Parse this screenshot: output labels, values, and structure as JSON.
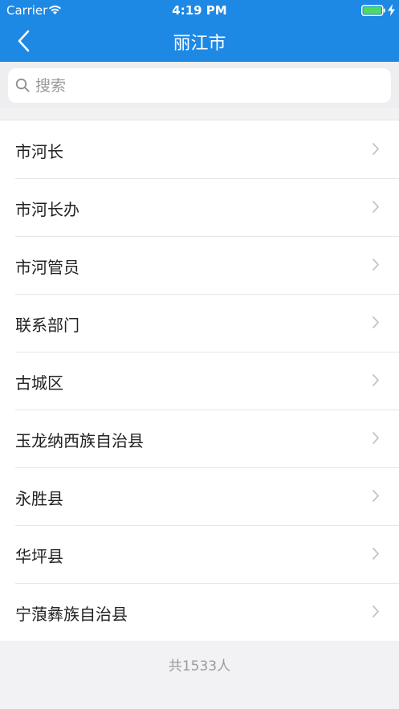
{
  "status_bar": {
    "carrier": "Carrier",
    "time": "4:19 PM",
    "battery_color": "#4cd964"
  },
  "nav": {
    "back_icon": "chevron-left-icon",
    "title": "丽江市"
  },
  "search": {
    "icon": "search-icon",
    "placeholder": "搜索",
    "value": ""
  },
  "list": {
    "items": [
      {
        "label": "市河长"
      },
      {
        "label": "市河长办"
      },
      {
        "label": "市河管员"
      },
      {
        "label": "联系部门"
      },
      {
        "label": "古城区"
      },
      {
        "label": "玉龙纳西族自治县"
      },
      {
        "label": "永胜县"
      },
      {
        "label": "华坪县"
      },
      {
        "label": "宁蒗彝族自治县"
      }
    ]
  },
  "footer": {
    "count_text": "共1533人"
  },
  "colors": {
    "header_bg": "#1e88e5",
    "page_bg": "#f2f2f4"
  }
}
